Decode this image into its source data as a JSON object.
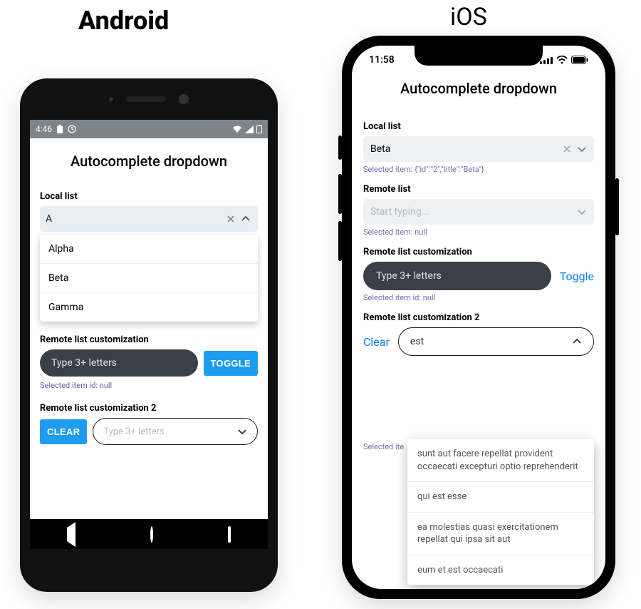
{
  "titles": {
    "android": "Android",
    "ios": "iOS"
  },
  "android": {
    "status": {
      "time": "4:46",
      "icons_right": "▾◢▯"
    },
    "page_title": "Autocomplete dropdown",
    "local_list": {
      "label": "Local list",
      "input_value": "A",
      "options": [
        "Alpha",
        "Beta",
        "Gamma"
      ]
    },
    "remote_custom": {
      "label": "Remote list customization",
      "placeholder": "Type 3+ letters",
      "toggle": "TOGGLE",
      "hint": "Selected item id: null"
    },
    "remote_custom2": {
      "label": "Remote list customization 2",
      "clear": "CLEAR",
      "placeholder": "Type 3+ letters"
    }
  },
  "ios": {
    "status": {
      "time": "11:58"
    },
    "page_title": "Autocomplete dropdown",
    "local_list": {
      "label": "Local list",
      "input_value": "Beta",
      "hint": "Selected item: {\"id\":\"2\",\"title\":\"Beta\"}"
    },
    "remote_list": {
      "label": "Remote list",
      "placeholder": "Start typing...",
      "hint": "Selected item: null"
    },
    "remote_custom": {
      "label": "Remote list customization",
      "placeholder": "Type 3+ letters",
      "toggle": "Toggle",
      "hint": "Selected item id: null"
    },
    "remote_custom2": {
      "label": "Remote list customization 2",
      "clear": "Clear",
      "input_value": "est",
      "hint_cut": "Selected ite",
      "options": [
        "sunt aut facere repellat provident occaecati excepturi optio reprehenderit",
        "qui est esse",
        "ea molestias quasi exercitationem repellat qui ipsa sit aut",
        "eum et est occaecati"
      ]
    }
  }
}
